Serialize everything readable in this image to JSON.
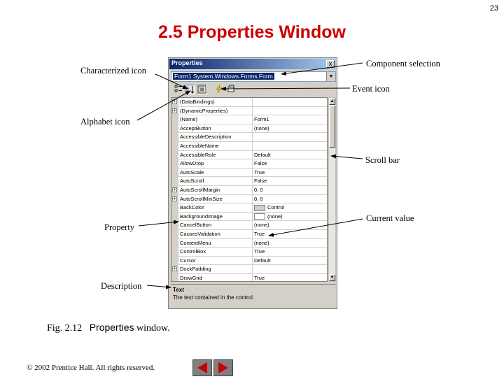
{
  "page_number": "23",
  "title": "2.5 Properties Window",
  "callouts": {
    "characterized_icon": "Characterized icon",
    "alphabet_icon": "Alphabet icon",
    "property": "Property",
    "description": "Description",
    "component_selection": "Component selection",
    "event_icon": "Event icon",
    "scroll_bar": "Scroll bar",
    "current_value": "Current value"
  },
  "window": {
    "title": "Properties",
    "close": "x",
    "component": "Form1  System.Windows.Forms.Form",
    "dropdown_icon": "chevron-down-icon",
    "toolbar_icons": [
      "categorized-icon",
      "alphabetical-icon",
      "properties-icon",
      "events-icon",
      "property-pages-icon"
    ]
  },
  "properties": [
    {
      "name": "(DataBindings)",
      "value": "",
      "expandable": true
    },
    {
      "name": "(DynamicProperties)",
      "value": "",
      "expandable": true
    },
    {
      "name": "(Name)",
      "value": "Form1",
      "expandable": false
    },
    {
      "name": "AcceptButton",
      "value": "(none)",
      "expandable": false
    },
    {
      "name": "AccessibleDescription",
      "value": "",
      "expandable": false
    },
    {
      "name": "AccessibleName",
      "value": "",
      "expandable": false
    },
    {
      "name": "AccessibleRole",
      "value": "Default",
      "expandable": false
    },
    {
      "name": "AllowDrop",
      "value": "False",
      "expandable": false
    },
    {
      "name": "AutoScale",
      "value": "True",
      "expandable": false
    },
    {
      "name": "AutoScroll",
      "value": "False",
      "expandable": false
    },
    {
      "name": "AutoScrollMargin",
      "value": "0, 0",
      "expandable": true
    },
    {
      "name": "AutoScrollMinSize",
      "value": "0, 0",
      "expandable": true
    },
    {
      "name": "BackColor",
      "value": "Control",
      "expandable": false,
      "swatch": "#d4d0c8"
    },
    {
      "name": "BackgroundImage",
      "value": "(none)",
      "expandable": false,
      "swatch": "#ffffff"
    },
    {
      "name": "CancelButton",
      "value": "(none)",
      "expandable": false
    },
    {
      "name": "CausesValidation",
      "value": "True",
      "expandable": false
    },
    {
      "name": "ContextMenu",
      "value": "(none)",
      "expandable": false
    },
    {
      "name": "ControlBox",
      "value": "True",
      "expandable": false
    },
    {
      "name": "Cursor",
      "value": "Default",
      "expandable": false
    },
    {
      "name": "DockPadding",
      "value": "",
      "expandable": true
    },
    {
      "name": "DrawGrid",
      "value": "True",
      "expandable": false
    }
  ],
  "description_panel": {
    "title": "Text",
    "text": "The text contained in the control."
  },
  "caption": {
    "number": "Fig. 2.12",
    "name": "Properties",
    "suffix": "window."
  },
  "copyright": "© 2002 Prentice Hall.  All rights reserved.",
  "colors": {
    "title": "#cc0000",
    "nav_button": "#808080",
    "nav_arrow": "#cc0000",
    "titlebar": "#0a246a"
  }
}
